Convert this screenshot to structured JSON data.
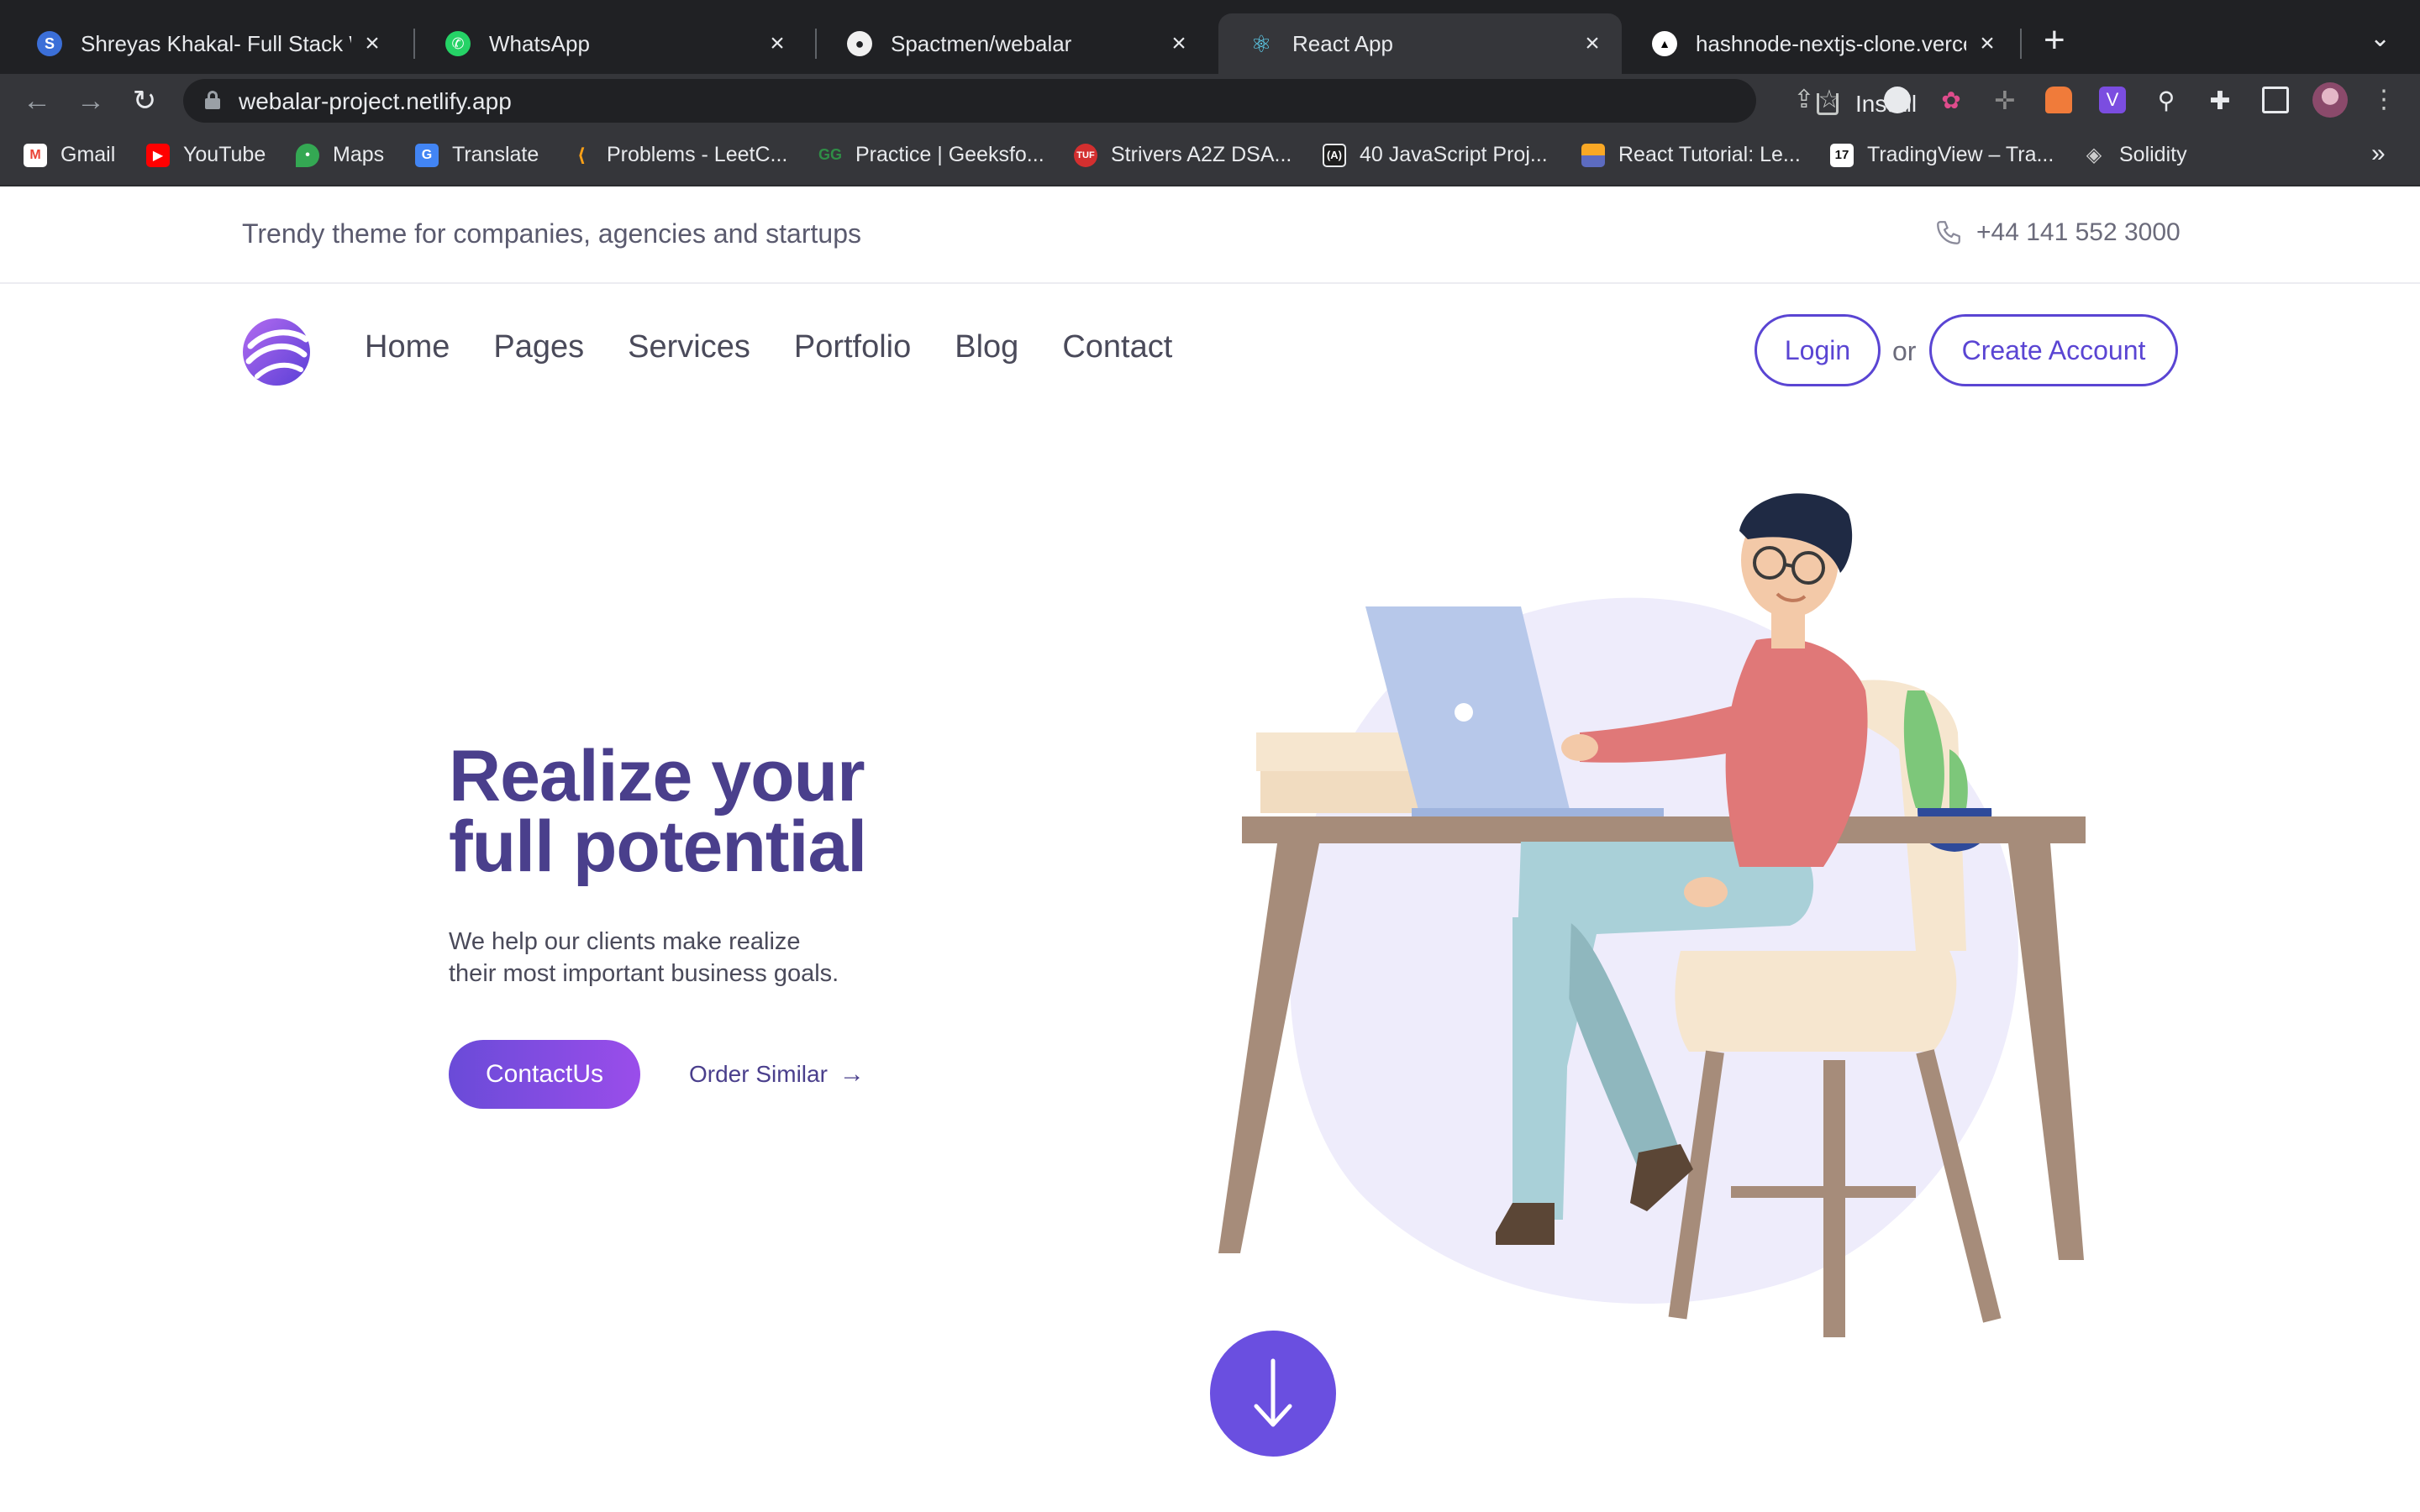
{
  "browser": {
    "tabs": [
      {
        "title": "Shreyas Khakal- Full Stack Web",
        "icon": "s-letter-icon",
        "active": false
      },
      {
        "title": "WhatsApp",
        "icon": "whatsapp-icon",
        "active": false
      },
      {
        "title": "Spactmen/webalar",
        "icon": "github-icon",
        "active": false
      },
      {
        "title": "React App",
        "icon": "react-icon",
        "active": true
      },
      {
        "title": "hashnode-nextjs-clone.vercel.a",
        "icon": "vercel-icon",
        "active": false
      }
    ],
    "tab_close_glyph": "×",
    "new_tab_glyph": "+",
    "url": "webalar-project.netlify.app",
    "install_label": "Install",
    "bookmarks": [
      {
        "label": "Gmail",
        "icon": "gmail-icon",
        "color": "#ea4335"
      },
      {
        "label": "YouTube",
        "icon": "youtube-icon",
        "color": "#ff0000"
      },
      {
        "label": "Maps",
        "icon": "maps-icon",
        "color": "#34a853"
      },
      {
        "label": "Translate",
        "icon": "translate-icon",
        "color": "#4285f4"
      },
      {
        "label": "Problems - LeetC...",
        "icon": "leetcode-icon",
        "color": "#ffa116"
      },
      {
        "label": "Practice | Geeksfo...",
        "icon": "geeksforgeeks-icon",
        "color": "#2f8d46"
      },
      {
        "label": "Strivers A2Z DSA...",
        "icon": "tuf-icon",
        "color": "#d32f2f"
      },
      {
        "label": "40 JavaScript Proj...",
        "icon": "javascript-icon",
        "color": "#1e1e1e"
      },
      {
        "label": "React Tutorial: Le...",
        "icon": "react-tutorial-icon",
        "color": "#f9a825"
      },
      {
        "label": "TradingView – Tra...",
        "icon": "tradingview-icon",
        "color": "#111111"
      },
      {
        "label": "Solidity",
        "icon": "solidity-icon",
        "color": "#cccccc"
      }
    ],
    "more_bookmarks_glyph": "»"
  },
  "site": {
    "topbar": {
      "tagline": "Trendy theme for companies, agencies and startups",
      "phone": "+44 141 552 3000"
    },
    "nav": {
      "links": [
        "Home",
        "Pages",
        "Services",
        "Portfolio",
        "Blog",
        "Contact"
      ],
      "login": "Login",
      "or": "or",
      "create_account": "Create Account"
    },
    "hero": {
      "title_line1": "Realize your",
      "title_line2": "full potential",
      "subtitle_line1": "We help our clients make realize",
      "subtitle_line2": "their most important business goals.",
      "primary_cta": "ContactUs",
      "secondary_cta": "Order Similar",
      "secondary_arrow": "→"
    }
  },
  "colors": {
    "brand": "#5a45d3",
    "heading": "#4a3f8c",
    "cta_gradient_start": "#6a4bd8",
    "cta_gradient_end": "#9a4dea",
    "scroll_button": "#6a4fe0",
    "blob": "#eeecfb"
  }
}
